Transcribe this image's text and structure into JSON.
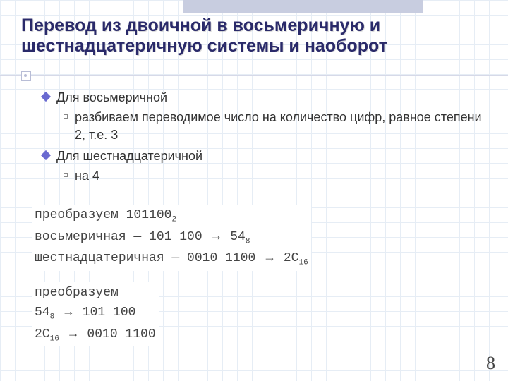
{
  "title": "Перевод из двоичной в восьмеричную и шестнадцатеричную системы и наоборот",
  "bullets": {
    "b1": "Для восьмеричной",
    "b1a": "разбиваем переводимое число на количество цифр, равное степени 2, т.е. 3",
    "b2": "Для шестнадцатеричной",
    "b2a": "на 4"
  },
  "example1": {
    "line1_pre": "преобразуем 101100",
    "line1_sub": "2",
    "line2_pre": "восьмеричная — 101 100 ",
    "line2_res": " 54",
    "line2_sub": "8",
    "line3_pre": "шестнадцатеричная — 0010 1100 ",
    "line3_res": " 2C",
    "line3_sub": "16"
  },
  "example2": {
    "line1": "преобразуем",
    "line2_pre": "54",
    "line2_sub": "8",
    "line2_post": " 101 100",
    "line3_pre": "2C",
    "line3_sub": "16",
    "line3_post": " 0010 1100"
  },
  "arrow": "→",
  "page_number": "8"
}
